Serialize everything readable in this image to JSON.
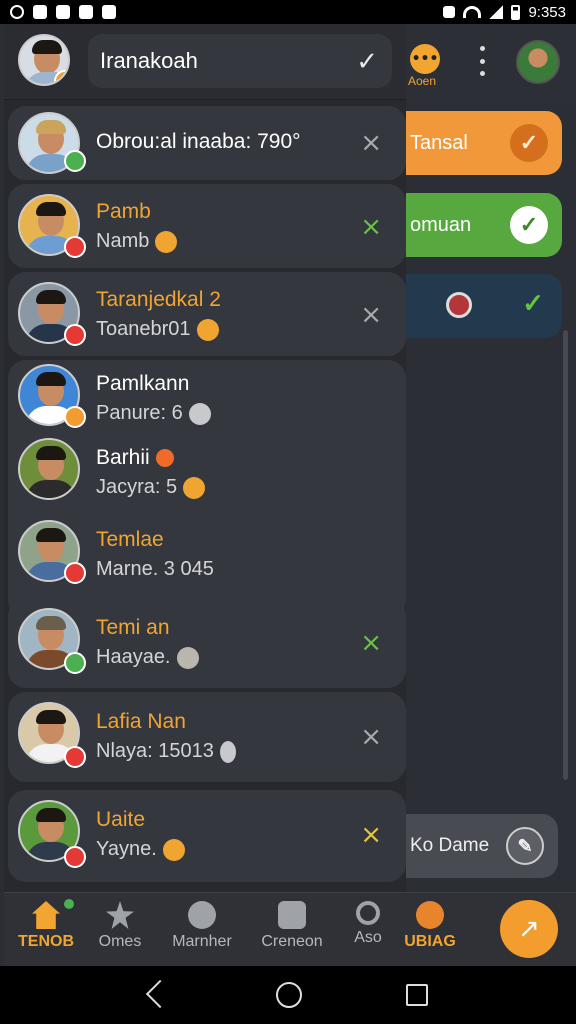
{
  "status_bar": {
    "time": "9:353"
  },
  "header": {
    "search_value": "Iranakoah",
    "badge_label": "Aoen"
  },
  "background_items": [
    {
      "label": "Tansal",
      "color": "#f0983a"
    },
    {
      "label": "omuan",
      "color": "#56a83f"
    },
    {
      "label": "",
      "color": "#22394e"
    },
    {
      "label": "Ko Dame",
      "color": "#484b52"
    }
  ],
  "drawer_items": [
    {
      "title": "Obrou:al inaaba: 790°",
      "subtitle": "",
      "title_color": "white",
      "action": "x-grey",
      "badge": "green"
    },
    {
      "title": "Pamb",
      "subtitle": "Namb",
      "title_color": "yellow",
      "action": "x-green",
      "badge": "red"
    },
    {
      "title": "Taranjedkal 2",
      "subtitle": "Toanebr01",
      "title_color": "yellow",
      "action": "x-grey",
      "badge": "red"
    },
    {
      "title": "Pamlkann",
      "subtitle": "Panure: 6",
      "title_color": "white",
      "action": "",
      "badge": "orange"
    },
    {
      "title": "Barhii",
      "subtitle": "Jacyra: 5",
      "title_color": "white",
      "action": "",
      "badge": ""
    },
    {
      "title": "Temlae",
      "subtitle": "Marne. 3 045",
      "title_color": "yellow",
      "action": "",
      "badge": "red"
    },
    {
      "title": "Temi an",
      "subtitle": "Haayae.",
      "title_color": "yellow",
      "action": "x-green",
      "badge": "green"
    },
    {
      "title": "Lafia Nan",
      "subtitle": "Nlaya: 15013",
      "title_color": "yellow",
      "action": "x-grey",
      "badge": "red"
    },
    {
      "title": "Uaite",
      "subtitle": "Yayne.",
      "title_color": "yellow",
      "action": "x-yellow",
      "badge": "red"
    }
  ],
  "bottom_nav": [
    {
      "label": "TENOB",
      "icon": "home-icon",
      "active": true
    },
    {
      "label": "Omes",
      "icon": "star-icon",
      "active": false
    },
    {
      "label": "Marnher",
      "icon": "list-icon",
      "active": false
    },
    {
      "label": "Creneon",
      "icon": "camera-icon",
      "active": false
    },
    {
      "label": "Aso",
      "icon": "search-icon",
      "active": false
    },
    {
      "label": "UBIAG",
      "icon": "recycle-icon",
      "active": true
    }
  ],
  "icons": {
    "close": "×",
    "check": "✓",
    "fab": "↗"
  }
}
